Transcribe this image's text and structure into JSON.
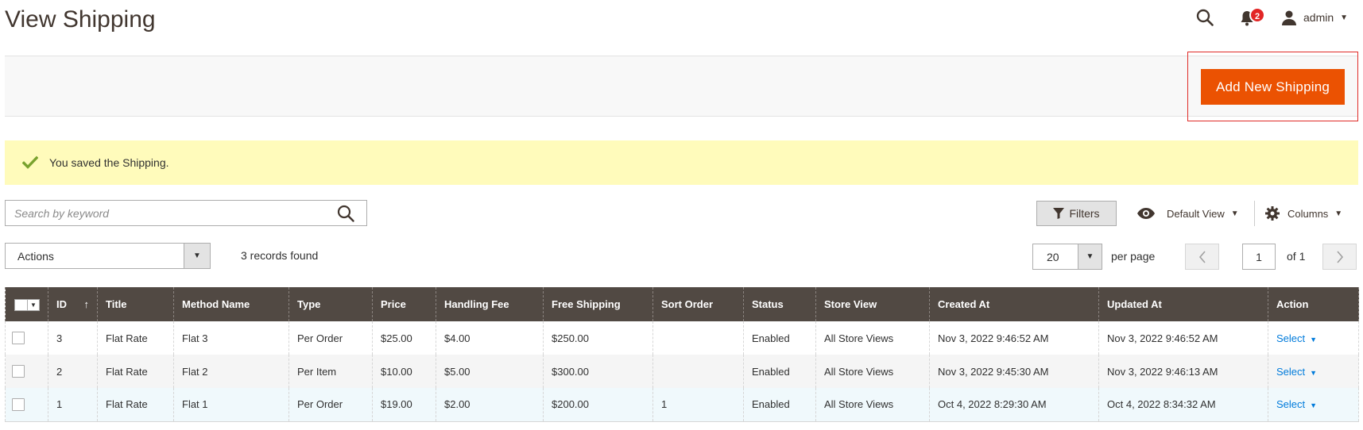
{
  "header": {
    "title": "View Shipping",
    "notifications_count": "2",
    "user_name": "admin"
  },
  "action_bar": {
    "add_button": "Add New Shipping"
  },
  "message": {
    "text": "You saved the Shipping."
  },
  "toolbar": {
    "search_placeholder": "Search by keyword",
    "filters_label": "Filters",
    "view_label": "Default View",
    "columns_label": "Columns",
    "actions_label": "Actions",
    "records_found": "3 records found",
    "per_page_value": "20",
    "per_page_label": "per page",
    "current_page": "1",
    "page_of": "of 1"
  },
  "grid": {
    "columns": [
      "ID",
      "Title",
      "Method Name",
      "Type",
      "Price",
      "Handling Fee",
      "Free Shipping",
      "Sort Order",
      "Status",
      "Store View",
      "Created At",
      "Updated At",
      "Action"
    ],
    "sort_indicator": "↑",
    "rows": [
      {
        "id": "3",
        "title": "Flat Rate",
        "method": "Flat 3",
        "type": "Per Order",
        "price": "$25.00",
        "fee": "$4.00",
        "free": "$250.00",
        "sort": "",
        "status": "Enabled",
        "store": "All Store Views",
        "created": "Nov 3, 2022 9:46:52 AM",
        "updated": "Nov 3, 2022 9:46:52 AM",
        "action": "Select"
      },
      {
        "id": "2",
        "title": "Flat Rate",
        "method": "Flat 2",
        "type": "Per Item",
        "price": "$10.00",
        "fee": "$5.00",
        "free": "$300.00",
        "sort": "",
        "status": "Enabled",
        "store": "All Store Views",
        "created": "Nov 3, 2022 9:45:30 AM",
        "updated": "Nov 3, 2022 9:46:13 AM",
        "action": "Select"
      },
      {
        "id": "1",
        "title": "Flat Rate",
        "method": "Flat 1",
        "type": "Per Order",
        "price": "$19.00",
        "fee": "$2.00",
        "free": "$200.00",
        "sort": "1",
        "status": "Enabled",
        "store": "All Store Views",
        "created": "Oct 4, 2022 8:29:30 AM",
        "updated": "Oct 4, 2022 8:34:32 AM",
        "action": "Select"
      }
    ]
  },
  "colors": {
    "accent": "#eb5202",
    "header_bg": "#514943",
    "message_bg": "#fffbbb",
    "link": "#007bdb",
    "badge": "#e22626"
  },
  "icons": {
    "search": "search-icon",
    "notifications": "bell-icon",
    "user": "user-icon",
    "success": "check-icon",
    "filters": "funnel-icon",
    "view": "eye-icon",
    "columns": "gear-icon"
  }
}
